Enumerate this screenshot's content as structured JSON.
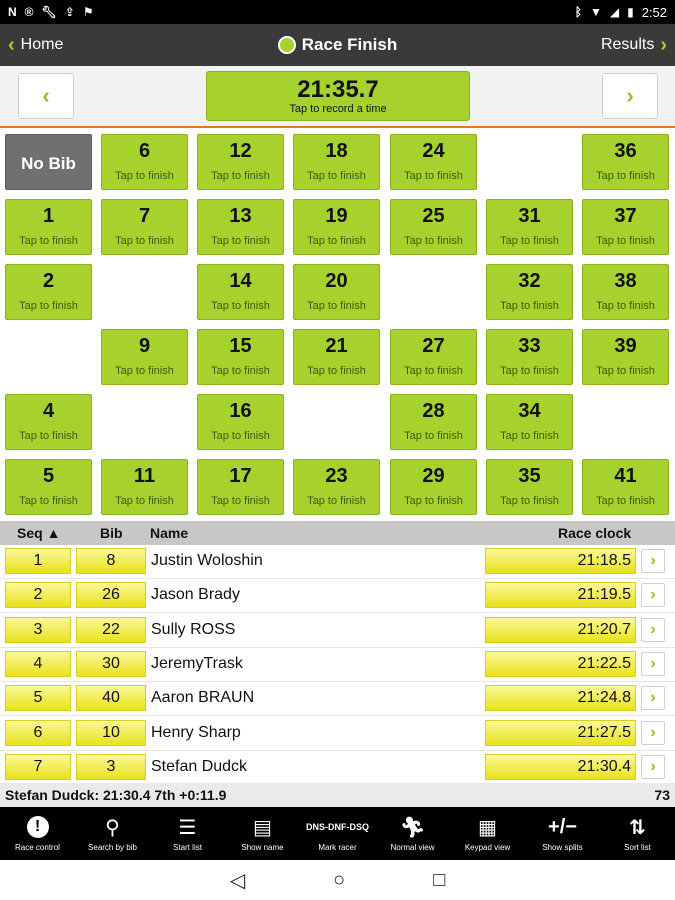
{
  "status_bar": {
    "left_icons": [
      "notification-n-icon",
      "notification-record-icon",
      "wrench-icon",
      "upload-icon",
      "flag-icon"
    ],
    "right_icons": [
      "bluetooth-icon",
      "wifi-icon",
      "signal-icon",
      "battery-icon"
    ],
    "time": "2:52"
  },
  "action_bar": {
    "home_label": "Home",
    "title": "Race Finish",
    "results_label": "Results"
  },
  "timer": {
    "value": "21:35.7",
    "hint": "Tap to record a time"
  },
  "grid": {
    "no_bib_label": "No Bib",
    "tap_label": "Tap to finish",
    "tiles": [
      [
        "6",
        "12",
        "18",
        "24",
        "",
        "36"
      ],
      [
        "1",
        "7",
        "13",
        "19",
        "25",
        "31",
        "37"
      ],
      [
        "2",
        "",
        "14",
        "20",
        "",
        "32",
        "38"
      ],
      [
        "",
        "9",
        "15",
        "21",
        "27",
        "33",
        "39"
      ],
      [
        "4",
        "",
        "16",
        "",
        "28",
        "34",
        ""
      ],
      [
        "5",
        "11",
        "17",
        "23",
        "29",
        "35",
        "41"
      ]
    ]
  },
  "results": {
    "headers": {
      "seq": "Seq ▲",
      "bib": "Bib",
      "name": "Name",
      "clock": "Race clock"
    },
    "rows": [
      {
        "seq": "1",
        "bib": "8",
        "name": "Justin Woloshin",
        "time": "21:18.5"
      },
      {
        "seq": "2",
        "bib": "26",
        "name": "Jason Brady",
        "time": "21:19.5"
      },
      {
        "seq": "3",
        "bib": "22",
        "name": "Sully ROSS",
        "time": "21:20.7"
      },
      {
        "seq": "4",
        "bib": "30",
        "name": "JeremyTrask",
        "time": "21:22.5"
      },
      {
        "seq": "5",
        "bib": "40",
        "name": "Aaron BRAUN",
        "time": "21:24.8"
      },
      {
        "seq": "6",
        "bib": "10",
        "name": "Henry Sharp",
        "time": "21:27.5"
      },
      {
        "seq": "7",
        "bib": "3",
        "name": "Stefan Dudck",
        "time": "21:30.4"
      }
    ]
  },
  "summary": {
    "text": "Stefan Dudck: 21:30.4 7th +0:11.9",
    "count": "73"
  },
  "toolbar": {
    "items": [
      {
        "label": "Race control",
        "icon": "alert-icon"
      },
      {
        "label": "Search by bib",
        "icon": "search-icon"
      },
      {
        "label": "Start list",
        "icon": "list-icon"
      },
      {
        "label": "Show name",
        "icon": "name-lines-icon"
      },
      {
        "label": "Mark racer",
        "icon": "dns-dnf-dsq-icon",
        "icon_text": "DNS-DNF-DSQ"
      },
      {
        "label": "Normal view",
        "icon": "runners-icon"
      },
      {
        "label": "Keypad view",
        "icon": "keypad-icon"
      },
      {
        "label": "Show splits",
        "icon": "plus-minus-icon",
        "icon_text": "+/−"
      },
      {
        "label": "Sort list",
        "icon": "sort-arrows-icon"
      }
    ]
  },
  "colors": {
    "tile_green": "#a7d22d",
    "action_bar": "#3a3a3a",
    "accent_orange": "#e07a1c",
    "time_yellow": "#e8e21b",
    "no_bib_gray": "#707070"
  }
}
